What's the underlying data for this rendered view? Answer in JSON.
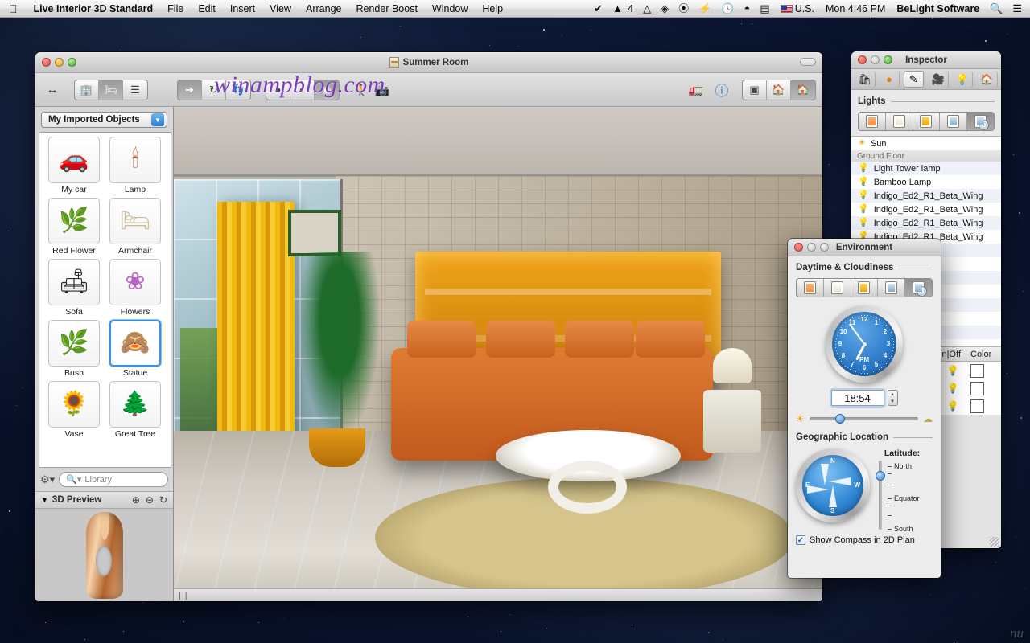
{
  "menubar": {
    "apple_icon": "apple-icon",
    "app_name": "Live Interior 3D Standard",
    "menus": [
      "File",
      "Edit",
      "Insert",
      "View",
      "Arrange",
      "Render Boost",
      "Window",
      "Help"
    ],
    "status_icons": [
      "check-circle-icon",
      "adobe-icon",
      "drive-icon",
      "dropbox-icon",
      "evernote-icon",
      "flash-icon",
      "clock-icon",
      "wifi-icon",
      "battery-icon"
    ],
    "adobe_badge": "4",
    "input_locale": "U.S.",
    "clock": "Mon 4:46 PM",
    "user": "BeLight Software",
    "spotlight_icon": "search-icon",
    "notification_icon": "list-icon"
  },
  "main_window": {
    "title": "Summer Room",
    "document_icon": "document-icon",
    "zoom_button": "zoom-button",
    "watermark": "winampblog.com",
    "toolbar": {
      "resize_icon": "arrows-horizontal-icon",
      "view_modes": [
        {
          "name": "building-view",
          "icon": "building-icon",
          "on": false
        },
        {
          "name": "furniture-view",
          "icon": "armchair-icon",
          "on": true
        },
        {
          "name": "list-view",
          "icon": "list-icon",
          "on": false
        }
      ],
      "tools": [
        {
          "name": "select-tool",
          "icon": "cursor-icon",
          "on": true
        },
        {
          "name": "rotate-tool",
          "icon": "rotate-icon",
          "on": false
        },
        {
          "name": "move-tool",
          "icon": "footsteps-icon",
          "on": false
        }
      ],
      "render_modes": [
        {
          "name": "flat-shading",
          "icon": "sphere-flat-icon",
          "on": false
        },
        {
          "name": "smooth-shading",
          "icon": "sphere-half-icon",
          "on": false
        },
        {
          "name": "glossy-shading",
          "icon": "sphere-gloss-icon",
          "on": true
        }
      ],
      "walk_icon": "walkthrough-icon",
      "camera_icon": "camera-icon",
      "render_icon": "render-truck-icon",
      "info_icon": "info-icon",
      "layouts": [
        {
          "name": "split-2d-view",
          "icon": "split-view-icon",
          "on": false
        },
        {
          "name": "2d-3d-view",
          "icon": "plan-house-icon",
          "on": false
        },
        {
          "name": "3d-view",
          "icon": "house-icon",
          "on": true
        }
      ]
    },
    "sidebar": {
      "collection": "My Imported Objects",
      "objects": [
        {
          "label": "My car",
          "icon": "car-icon"
        },
        {
          "label": "Lamp",
          "icon": "chandelier-icon"
        },
        {
          "label": "Red Flower",
          "icon": "flower-grass-icon"
        },
        {
          "label": "Armchair",
          "icon": "armchair-icon"
        },
        {
          "label": "Sofa",
          "icon": "sofa-icon"
        },
        {
          "label": "Flowers",
          "icon": "flower-icon"
        },
        {
          "label": "Bush",
          "icon": "bush-icon"
        },
        {
          "label": "Statue",
          "icon": "statue-icon",
          "selected": true
        },
        {
          "label": "Vase",
          "icon": "vase-icon"
        },
        {
          "label": "Great Tree",
          "icon": "tree-icon"
        }
      ],
      "gear_icon": "gear-icon",
      "search_placeholder": "Library",
      "search_icon": "search-icon",
      "preview_title": "3D Preview",
      "disclosure_icon": "triangle-down-icon",
      "preview_tools": [
        "zoom-in-icon",
        "zoom-out-icon",
        "rotate-icon"
      ]
    },
    "status_grip": "resize-grip"
  },
  "inspector": {
    "title": "Inspector",
    "tabs": [
      {
        "name": "object-tab",
        "icon": "furniture-ruler-icon",
        "on": false
      },
      {
        "name": "material-tab",
        "icon": "sphere-icon",
        "on": false
      },
      {
        "name": "edit-tab",
        "icon": "pencil-icon",
        "on": true
      },
      {
        "name": "camera-tab",
        "icon": "camera-icon",
        "on": false
      },
      {
        "name": "light-tab",
        "icon": "bulb-icon",
        "on": false
      },
      {
        "name": "site-tab",
        "icon": "house-icon",
        "on": false
      }
    ],
    "section_title": "Lights",
    "light_modes": [
      {
        "name": "dawn-light",
        "class": "dawn",
        "on": false
      },
      {
        "name": "day-light",
        "class": "day",
        "on": false
      },
      {
        "name": "dusk-light",
        "class": "dusk",
        "on": false
      },
      {
        "name": "night-light",
        "class": "night",
        "on": false
      },
      {
        "name": "auto-time-light",
        "class": "auto",
        "on": true
      }
    ],
    "list": [
      {
        "label": "Sun",
        "icon": "sun-icon",
        "type": "item"
      },
      {
        "label": "Ground Floor",
        "type": "group"
      },
      {
        "label": "Light Tower lamp",
        "icon": "bulb-on-icon",
        "type": "item"
      },
      {
        "label": "Bamboo Lamp",
        "icon": "bulb-off-icon",
        "type": "item"
      },
      {
        "label": "Indigo_Ed2_R1_Beta_Wing",
        "icon": "bulb-off-icon",
        "type": "item"
      },
      {
        "label": "Indigo_Ed2_R1_Beta_Wing",
        "icon": "bulb-off-icon",
        "type": "item"
      },
      {
        "label": "Indigo_Ed2_R1_Beta_Wing",
        "icon": "bulb-off-icon",
        "type": "item"
      },
      {
        "label": "Indigo_Ed2_R1_Beta_Wing",
        "icon": "bulb-off-icon",
        "type": "item"
      }
    ],
    "table": {
      "columns": [
        "",
        "On|Off",
        "Color"
      ],
      "rows": [
        {
          "state": "bulb-on-icon",
          "color": "#ffffff"
        },
        {
          "state": "bulb-off-icon",
          "color": "#ffffff"
        },
        {
          "state": "bulb-on-icon",
          "color": "#ffffff"
        }
      ]
    }
  },
  "environment": {
    "title": "Environment",
    "daytime_section": "Daytime & Cloudiness",
    "daytime_modes": [
      {
        "name": "dawn-mode",
        "class": "dawn",
        "on": false
      },
      {
        "name": "day-mode",
        "class": "day",
        "on": false
      },
      {
        "name": "dusk-mode",
        "class": "dusk",
        "on": false
      },
      {
        "name": "night-mode",
        "class": "night",
        "on": false
      },
      {
        "name": "auto-time-mode",
        "class": "auto",
        "on": true
      }
    ],
    "clock": {
      "numbers": [
        "12",
        "1",
        "2",
        "3",
        "4",
        "5",
        "6",
        "7",
        "8",
        "9",
        "10",
        "11"
      ],
      "meridiem": "PM",
      "hour_angle": 207,
      "minute_angle": 324
    },
    "time_value": "18:54",
    "stepper_up": "▲",
    "stepper_down": "▼",
    "cloud_min_icon": "sun-icon",
    "cloud_max_icon": "cloud-icon",
    "cloudiness_percent": 28,
    "geo_section": "Geographic Location",
    "compass_dirs": [
      "N",
      "E",
      "S",
      "W"
    ],
    "latitude_label": "Latitude:",
    "latitude_ticks": [
      "North",
      "Equator",
      "South"
    ],
    "latitude_knob_percent": 22,
    "show_compass_label": "Show Compass in 2D Plan",
    "show_compass_checked": true,
    "check_glyph": "✓"
  }
}
